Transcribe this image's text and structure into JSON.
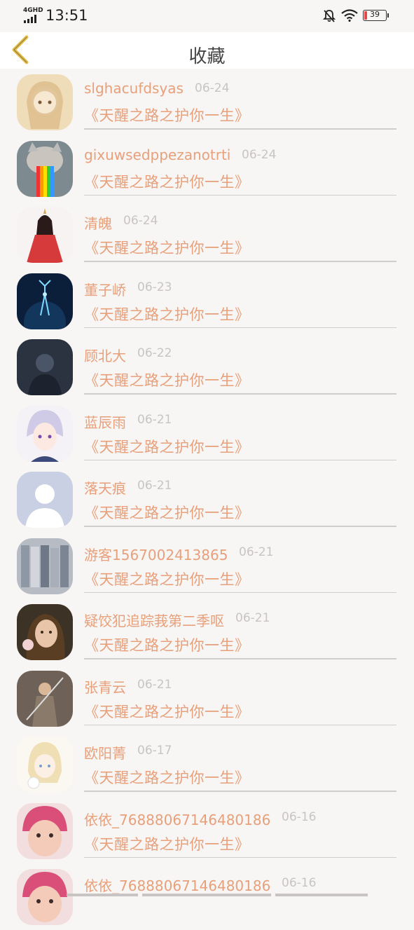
{
  "status_bar": {
    "network": "4GHD",
    "time": "13:51",
    "battery": "39"
  },
  "header": {
    "title": "收藏"
  },
  "favorites": [
    {
      "name": "slghacufdsyas",
      "date": "06-24",
      "novel": "《天醒之路之护你一生》",
      "avatar": "anime-girl-sketch"
    },
    {
      "name": "gixuwsedppezanotrti",
      "date": "06-24",
      "novel": "《天醒之路之护你一生》",
      "avatar": "cat-rainbow"
    },
    {
      "name": "清魄",
      "date": "06-24",
      "novel": "《天醒之路之护你一生》",
      "avatar": "red-dress-girl"
    },
    {
      "name": "董子峤",
      "date": "06-23",
      "novel": "《天醒之路之护你一生》",
      "avatar": "glowing-deer"
    },
    {
      "name": "顾北大",
      "date": "06-22",
      "novel": "《天醒之路之护你一生》",
      "avatar": "dark-figure"
    },
    {
      "name": "蓝辰雨",
      "date": "06-21",
      "novel": "《天醒之路之护你一生》",
      "avatar": "anime-boy"
    },
    {
      "name": "落天痕",
      "date": "06-21",
      "novel": "《天醒之路之护你一生》",
      "avatar": "default-person"
    },
    {
      "name": "游客1567002413865",
      "date": "06-21",
      "novel": "《天醒之路之护你一生》",
      "avatar": "clothes-rack"
    },
    {
      "name": "疑饺犯追踪莪第二季呕",
      "date": "06-21",
      "novel": "《天醒之路之护你一生》",
      "avatar": "woman-portrait"
    },
    {
      "name": "张青云",
      "date": "06-21",
      "novel": "《天醒之路之护你一生》",
      "avatar": "warrior"
    },
    {
      "name": "欧阳菁",
      "date": "06-17",
      "novel": "《天醒之路之护你一生》",
      "avatar": "anime-cat-girl"
    },
    {
      "name": "依依_76888067146480186",
      "date": "06-16",
      "novel": "《天醒之路之护你一生》",
      "avatar": "baby"
    },
    {
      "name": "依依_76888067146480186",
      "date": "06-16",
      "novel": "",
      "avatar": "baby"
    }
  ]
}
